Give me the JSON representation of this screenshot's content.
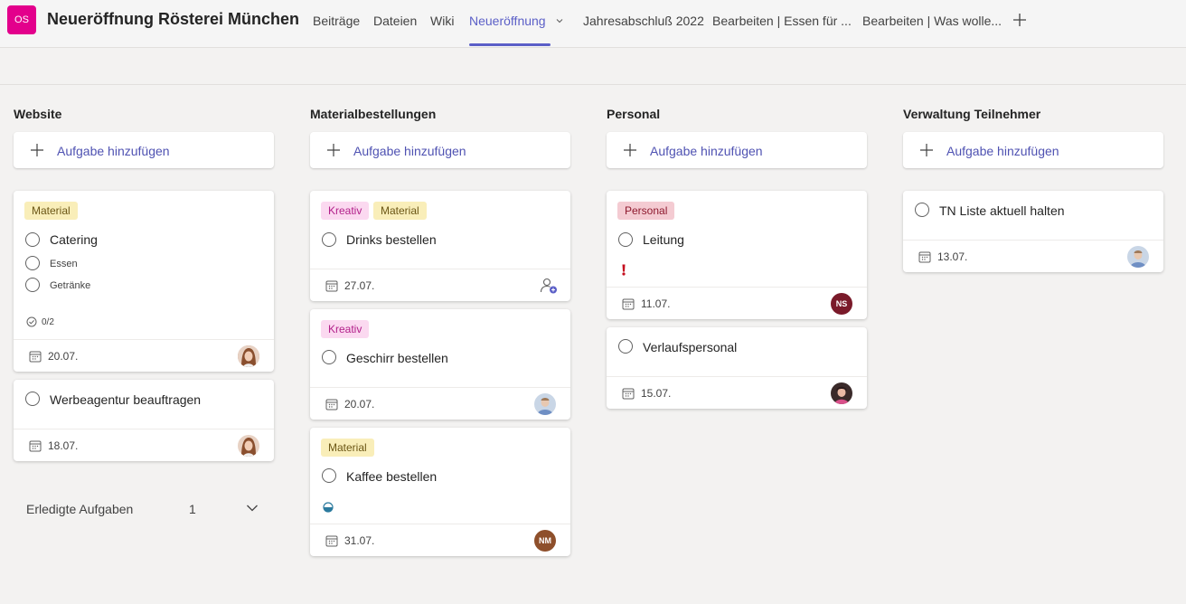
{
  "header": {
    "team_avatar": "OS",
    "team_title": "Neueröffnung Rösterei München",
    "tabs": [
      {
        "label": "Beiträge"
      },
      {
        "label": "Dateien"
      },
      {
        "label": "Wiki"
      },
      {
        "label": "Neueröffnung"
      },
      {
        "label": "Jahresabschluß 2022"
      },
      {
        "label": "Bearbeiten | Essen für ..."
      },
      {
        "label": "Bearbeiten | Was wolle..."
      }
    ],
    "active_tab": "Neueröffnung",
    "accent_color": "#5b5fc7",
    "add_tab_icon": "plus-icon",
    "tab_menu_icon": "chevron-down-icon"
  },
  "board": {
    "add_task_label": "Aufgabe hinzufügen",
    "columns": [
      {
        "title": "Website",
        "cards": [
          {
            "labels": [
              "Material"
            ],
            "title": "Catering",
            "checklist": [
              "Essen",
              "Getränke"
            ],
            "progress": "0/2",
            "date": "20.07.",
            "assignee": "avatar-photo-woman"
          },
          {
            "title": "Werbeagentur beauftragen",
            "date": "18.07.",
            "assignee": "avatar-photo-woman"
          }
        ],
        "completed": {
          "label": "Erledigte Aufgaben",
          "count": "1"
        }
      },
      {
        "title": "Materialbestellungen",
        "cards": [
          {
            "labels": [
              "Kreativ",
              "Material"
            ],
            "title": "Drinks bestellen",
            "date": "27.07.",
            "assignee": "assign-person-icon"
          },
          {
            "labels": [
              "Kreativ"
            ],
            "title": "Geschirr bestellen",
            "date": "20.07.",
            "assignee": "avatar-photo-man"
          },
          {
            "labels": [
              "Material"
            ],
            "title": "Kaffee bestellen",
            "status_icon": "half-progress-icon",
            "date": "31.07.",
            "assignee_initials": "NM"
          }
        ]
      },
      {
        "title": "Personal",
        "cards": [
          {
            "labels": [
              "Personal"
            ],
            "title": "Leitung",
            "priority_icon": "urgent-exclamation-icon",
            "date": "11.07.",
            "assignee_initials": "NS"
          },
          {
            "title": "Verlaufspersonal",
            "date": "15.07.",
            "assignee": "avatar-photo-woman-2"
          }
        ]
      },
      {
        "title": "Verwaltung Teilnehmer",
        "cards": [
          {
            "title": "TN Liste aktuell halten",
            "date": "13.07.",
            "assignee": "avatar-photo-man"
          }
        ]
      }
    ]
  },
  "colors": {
    "tag_material": "#f9eeb9",
    "tag_kreativ": "#fbd9f0",
    "tag_personal": "#f4cbd2",
    "avatar_ns": "#7a1a2a",
    "avatar_nm": "#8e4f2b",
    "team_avatar": "#e3008c"
  }
}
